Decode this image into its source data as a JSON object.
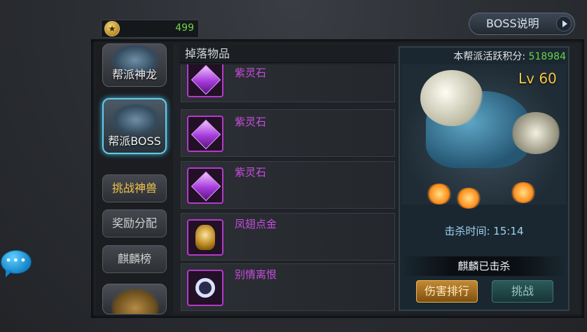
{
  "currency": {
    "value": "499"
  },
  "header": {
    "boss_help_label": "BOSS说明"
  },
  "sidebar": {
    "items": [
      {
        "label": "帮派神龙"
      },
      {
        "label": "帮派BOSS"
      },
      {
        "label": "挑战神兽"
      },
      {
        "label": "奖励分配"
      },
      {
        "label": "麒麟榜"
      }
    ]
  },
  "drops": {
    "title": "掉落物品",
    "items": [
      {
        "name": "紫灵石",
        "icon": "purple-gem-icon"
      },
      {
        "name": "紫灵石",
        "icon": "purple-gem-icon"
      },
      {
        "name": "紫灵石",
        "icon": "purple-gem-icon"
      },
      {
        "name": "凤翅点金",
        "icon": "golden-helmet-icon"
      },
      {
        "name": "别情离恨",
        "icon": "ring-icon"
      }
    ]
  },
  "boss": {
    "activity_label": "本帮派活跃积分:",
    "activity_value": "518984",
    "level": "Lv 60",
    "kill_time": "击杀时间: 15:14",
    "status": "麒麟已击杀",
    "damage_rank_label": "伤害排行",
    "challenge_label": "挑战"
  },
  "colors": {
    "accent_green": "#69d24d",
    "gold": "#f4c642",
    "purple": "#c74de0"
  }
}
